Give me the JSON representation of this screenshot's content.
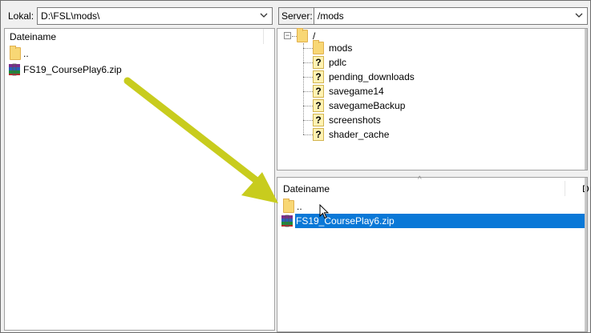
{
  "local": {
    "label": "Lokal:",
    "path": "D:\\FSL\\mods\\",
    "column_header": "Dateiname",
    "files": [
      {
        "name": "..",
        "icon": "folder-icon"
      },
      {
        "name": "FS19_CoursePlay6.zip",
        "icon": "winrar-archive-icon"
      }
    ]
  },
  "server": {
    "label": "Server:",
    "path": "/mods",
    "tree": {
      "root": "/",
      "children": [
        {
          "name": "mods",
          "icon": "folder-icon"
        },
        {
          "name": "pdlc",
          "icon": "unknown-folder-icon"
        },
        {
          "name": "pending_downloads",
          "icon": "unknown-folder-icon"
        },
        {
          "name": "savegame14",
          "icon": "unknown-folder-icon"
        },
        {
          "name": "savegameBackup",
          "icon": "unknown-folder-icon"
        },
        {
          "name": "screenshots",
          "icon": "unknown-folder-icon"
        },
        {
          "name": "shader_cache",
          "icon": "unknown-folder-icon"
        }
      ]
    },
    "column_header": "Dateiname",
    "column_header_2": "D",
    "sort_indicator": "^",
    "files": [
      {
        "name": "..",
        "icon": "folder-icon"
      },
      {
        "name": "FS19_CoursePlay6.zip",
        "icon": "winrar-archive-icon",
        "selected": true
      }
    ]
  },
  "annotation": {
    "arrow_color": "#c8cc1e"
  },
  "colors": {
    "selection": "#0a78d7",
    "folder": "#f8d775"
  }
}
